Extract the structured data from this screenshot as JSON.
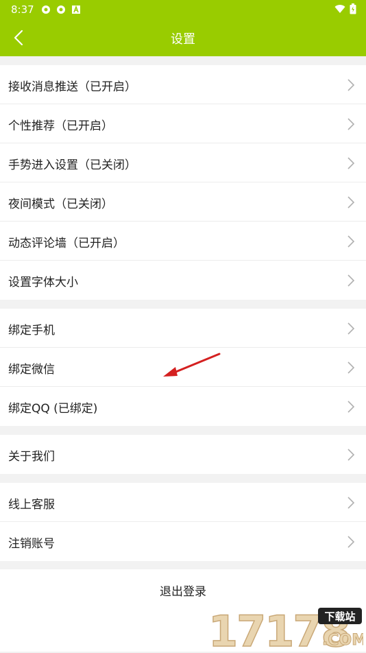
{
  "status_bar": {
    "time": "8:37"
  },
  "header": {
    "title": "设置"
  },
  "groups": [
    {
      "items": [
        {
          "label": "接收消息推送（已开启）"
        },
        {
          "label": "个性推荐（已开启）"
        },
        {
          "label": "手势进入设置（已关闭）"
        },
        {
          "label": "夜间模式（已关闭）"
        },
        {
          "label": "动态评论墙（已开启）"
        },
        {
          "label": "设置字体大小"
        }
      ]
    },
    {
      "items": [
        {
          "label": "绑定手机"
        },
        {
          "label": "绑定微信"
        },
        {
          "label": "绑定QQ (已绑定)"
        }
      ]
    },
    {
      "items": [
        {
          "label": "关于我们"
        }
      ]
    },
    {
      "items": [
        {
          "label": "线上客服"
        },
        {
          "label": "注销账号"
        }
      ]
    }
  ],
  "logout": {
    "label": "退出登录"
  },
  "watermark": {
    "text": "17178",
    "badge": "下载站",
    "suffix": ".COM"
  },
  "colors": {
    "header_bg": "#99cc00",
    "annotation_arrow": "#d42020"
  }
}
